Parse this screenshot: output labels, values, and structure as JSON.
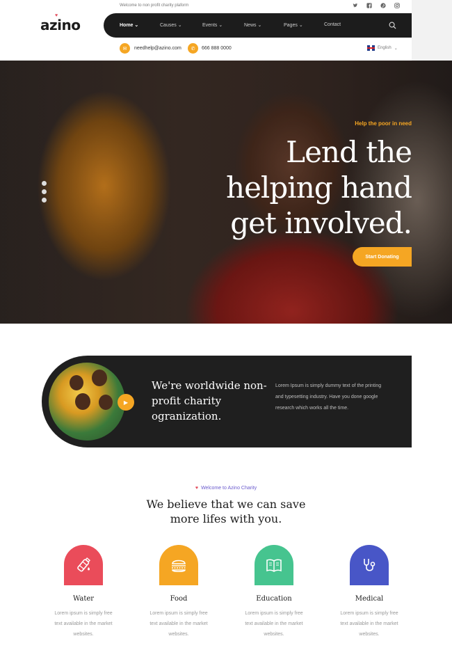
{
  "header": {
    "logo": "azino",
    "topbar_text": "Welcome to non profit charity plaform",
    "social": [
      "twitter-icon",
      "facebook-icon",
      "pinterest-icon",
      "instagram-icon"
    ],
    "nav": [
      {
        "label": "Home",
        "has_dropdown": true,
        "active": true
      },
      {
        "label": "Causes",
        "has_dropdown": true
      },
      {
        "label": "Events",
        "has_dropdown": true
      },
      {
        "label": "News",
        "has_dropdown": true
      },
      {
        "label": "Pages",
        "has_dropdown": true
      },
      {
        "label": "Contact",
        "has_dropdown": false
      }
    ],
    "email": "needhelp@azino.com",
    "phone": "666 888 0000",
    "language": "English"
  },
  "hero": {
    "tag": "Help the poor in need",
    "title_lines": [
      "Lend the",
      "helping hand",
      "get involved."
    ],
    "button": "Start Donating"
  },
  "about": {
    "title": "We're worldwide non-profit charity ogranization.",
    "text": "Lorem Ipsum is simply dummy text of the printing and typesetting industry. Have you done google research which works all the time."
  },
  "features_section": {
    "tag": "Welcome to Azino Charity",
    "title_lines": [
      "We believe that we can save",
      "more lifes with you."
    ],
    "items": [
      {
        "title": "Water",
        "text": "Lorem ipsum is simply free text available in the market websites.",
        "color": "#ea4c5a",
        "icon": "water-bottle-icon"
      },
      {
        "title": "Food",
        "text": "Lorem ipsum is simply free text available in the market websites.",
        "color": "#f5a623",
        "icon": "burger-icon"
      },
      {
        "title": "Education",
        "text": "Lorem ipsum is simply free text available in the market websites.",
        "color": "#46c48f",
        "icon": "book-icon"
      },
      {
        "title": "Medical",
        "text": "Lorem ipsum is simply free text available in the market websites.",
        "color": "#4856c7",
        "icon": "stethoscope-icon"
      }
    ]
  },
  "colors": {
    "accent": "#f5a623",
    "dark": "#1f1f1f"
  }
}
